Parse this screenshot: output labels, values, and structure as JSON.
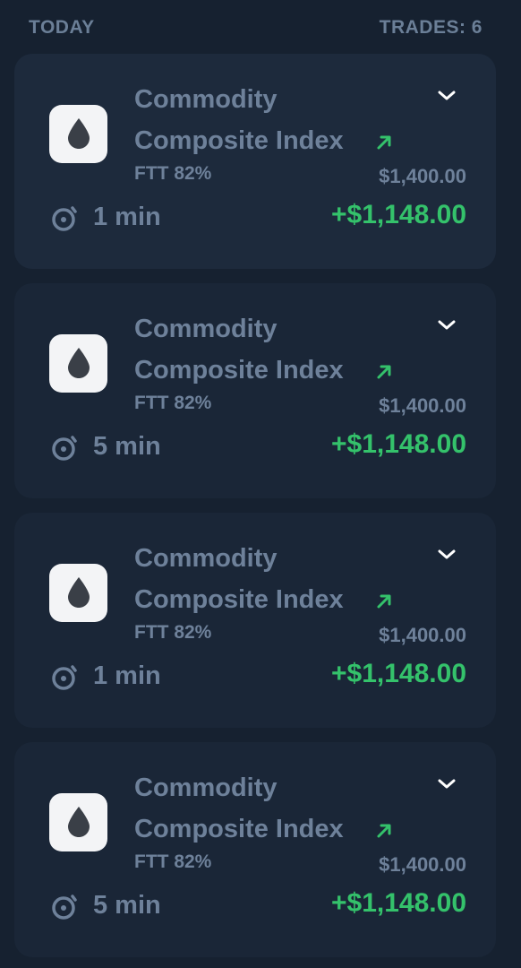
{
  "header": {
    "section_label": "TODAY",
    "trades_count_label": "TRADES: 6"
  },
  "colors": {
    "background": "#162130",
    "card_bg": "#1a2637",
    "text_muted": "#6e819a",
    "profit_green": "#34c26b",
    "icon_bg": "#f3f4f6",
    "icon_fg": "#3a3f47"
  },
  "trades": [
    {
      "asset_name": "Commodity Composite Index",
      "icon": "oil-drop-icon",
      "ftt": "FTT 82%",
      "amount": "$1,400.00",
      "direction": "up",
      "duration": "1 min",
      "profit": "+$1,148.00"
    },
    {
      "asset_name": "Commodity Composite Index",
      "icon": "oil-drop-icon",
      "ftt": "FTT 82%",
      "amount": "$1,400.00",
      "direction": "up",
      "duration": "5 min",
      "profit": "+$1,148.00"
    },
    {
      "asset_name": "Commodity Composite Index",
      "icon": "oil-drop-icon",
      "ftt": "FTT 82%",
      "amount": "$1,400.00",
      "direction": "up",
      "duration": "1 min",
      "profit": "+$1,148.00"
    },
    {
      "asset_name": "Commodity Composite Index",
      "icon": "oil-drop-icon",
      "ftt": "FTT 82%",
      "amount": "$1,400.00",
      "direction": "up",
      "duration": "5 min",
      "profit": "+$1,148.00"
    }
  ]
}
